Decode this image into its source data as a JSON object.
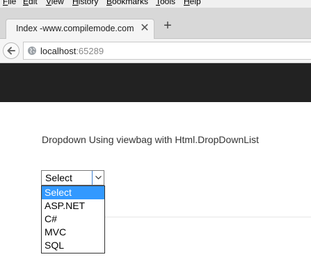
{
  "menu": {
    "items": [
      {
        "acc": "F",
        "rest": "ile"
      },
      {
        "acc": "E",
        "rest": "dit"
      },
      {
        "acc": "V",
        "rest": "iew"
      },
      {
        "acc": "H",
        "rest": "istory"
      },
      {
        "acc": "B",
        "rest": "ookmarks"
      },
      {
        "acc": "T",
        "rest": "ools"
      },
      {
        "acc": "H",
        "rest": "elp"
      }
    ]
  },
  "tab": {
    "title": "Index -www.compilemode.com",
    "close_glyph": "✕"
  },
  "new_tab_glyph": "+",
  "url": {
    "host": "localhost",
    "port": ":65289"
  },
  "page": {
    "heading": "Dropdown Using viewbag with Html.DropDownList"
  },
  "dropdown": {
    "selected": "Select",
    "options": [
      "Select",
      "ASP.NET",
      "C#",
      "MVC",
      "SQL"
    ],
    "highlighted_index": 0
  },
  "colors": {
    "header_band": "#222222",
    "highlight": "#3399ff"
  }
}
